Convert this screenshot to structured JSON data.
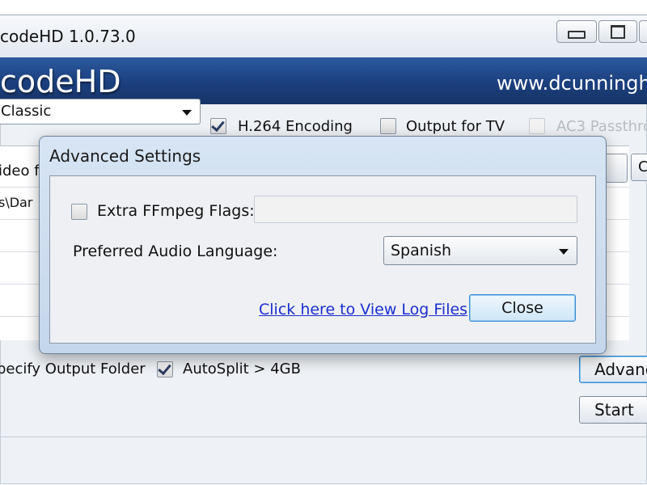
{
  "window": {
    "title": "codeHD 1.0.73.0"
  },
  "banner": {
    "app_name": "codeHD",
    "url": "www.dcunningha"
  },
  "options": {
    "preset_value": "Classic",
    "h264_label": "H.264 Encoding",
    "h264_checked": true,
    "output_tv_label": "Output for TV",
    "output_tv_checked": false,
    "ac3_label": "AC3 Passthro",
    "ac3_checked": false
  },
  "grid": {
    "header_text": "ideo fi",
    "cell_text": "s\\Dar",
    "small_button_label": "C"
  },
  "bottom": {
    "output_folder_label": "pecify Output Folder",
    "autosplit_label": "AutoSplit > 4GB",
    "autosplit_checked": true,
    "advanced_button_label": "Advanc",
    "start_button_label": "Start"
  },
  "dialog": {
    "title": "Advanced Settings",
    "extra_flags_label": "Extra FFmpeg Flags:",
    "extra_flags_checked": false,
    "extra_flags_value": "",
    "audio_language_label": "Preferred Audio Language:",
    "audio_language_value": "Spanish",
    "log_link_label": "Click here to View Log Files",
    "close_button_label": "Close"
  }
}
